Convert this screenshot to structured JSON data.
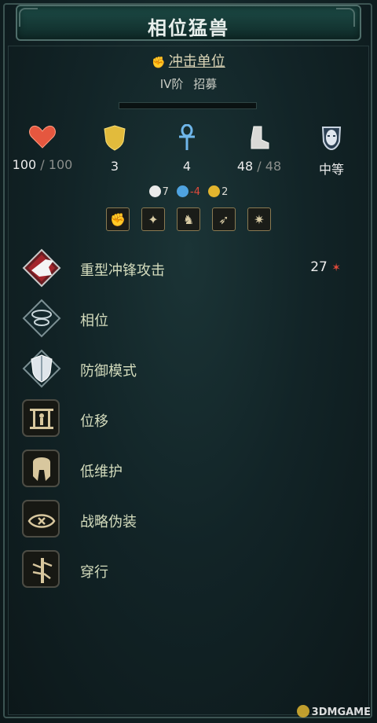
{
  "title": "相位猛兽",
  "unit_type": "冲击单位",
  "tier_text": "IV阶",
  "recruit_text": "招募",
  "stats": {
    "hp": {
      "current": "100",
      "sep": " / ",
      "max": "100"
    },
    "defense": "3",
    "resistance": "4",
    "moves": {
      "current": "48",
      "sep": " / ",
      "max": "48"
    },
    "morale": "中等"
  },
  "resistances": [
    {
      "icon": "shield-up-icon",
      "value": "7",
      "color": "#ffffff"
    },
    {
      "icon": "lightning-shield-icon",
      "value": "-4",
      "color": "#4fa3e0"
    },
    {
      "icon": "spiral-shield-icon",
      "value": "2",
      "color": "#e3b52e"
    }
  ],
  "traits": [
    {
      "icon": "fist-icon",
      "glyph": "✊"
    },
    {
      "icon": "paw-icon",
      "glyph": "✦"
    },
    {
      "icon": "creature-icon",
      "glyph": "♞"
    },
    {
      "icon": "horn-icon",
      "glyph": "➶"
    },
    {
      "icon": "shadow-eye-icon",
      "glyph": "✷"
    }
  ],
  "abilities": [
    {
      "name": "重型冲锋攻击",
      "damage": "27",
      "icon": "heavy-charge-icon"
    },
    {
      "name": "相位",
      "icon": "phase-icon"
    },
    {
      "name": "防御模式",
      "icon": "defense-mode-icon"
    },
    {
      "name": "位移",
      "icon": "displace-icon"
    },
    {
      "name": "低维护",
      "icon": "helmet-icon"
    },
    {
      "name": "战略伪装",
      "icon": "crossed-eye-icon"
    },
    {
      "name": "穿行",
      "icon": "pass-through-icon"
    }
  ],
  "watermark": "3DMGAME"
}
